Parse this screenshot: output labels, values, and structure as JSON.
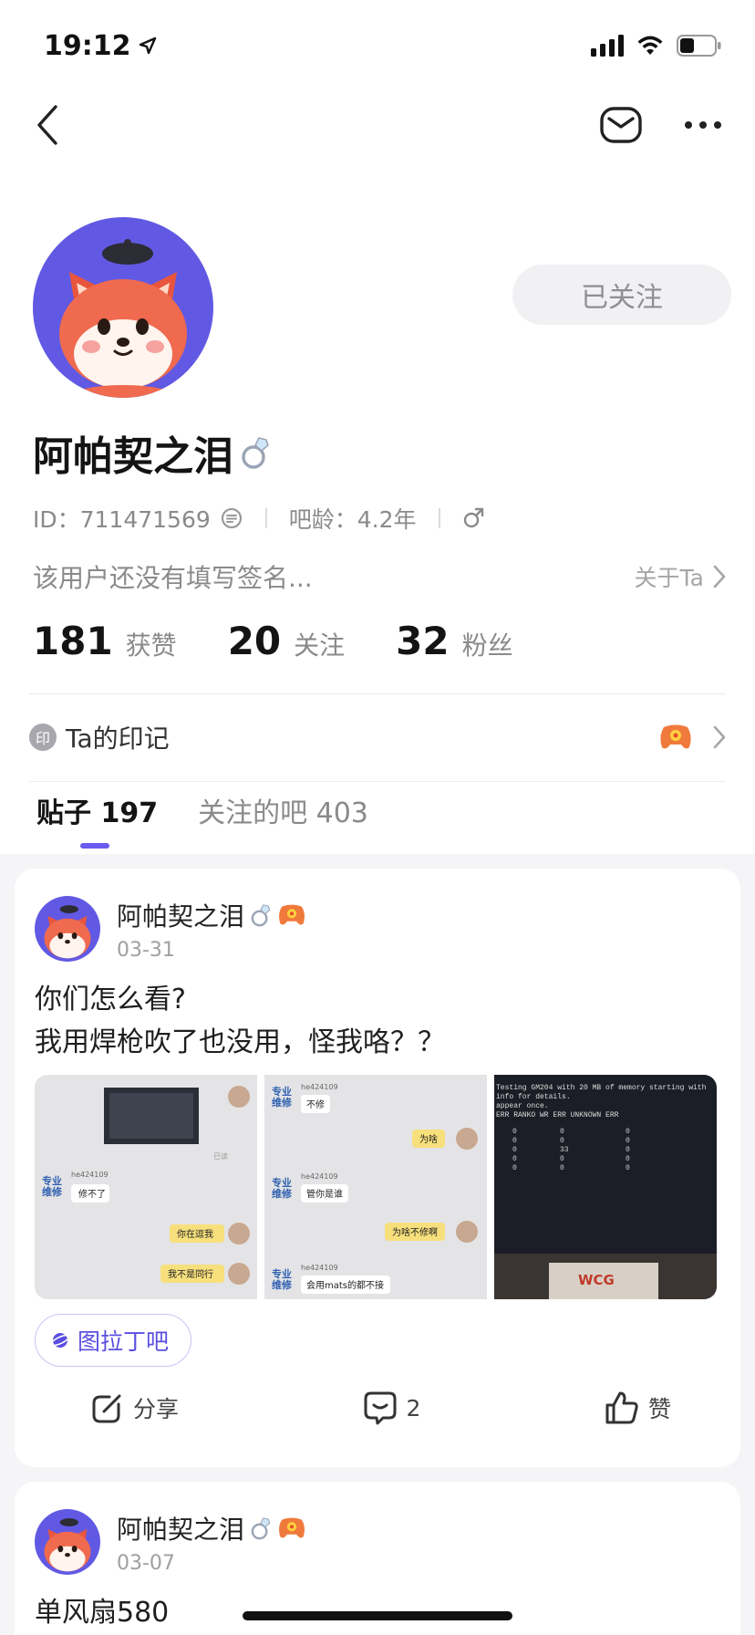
{
  "status": {
    "time": "19:12"
  },
  "profile": {
    "follow_label": "已关注",
    "name": "阿帕契之泪",
    "id_text": "ID：711471569",
    "age_text": "吧龄：4.2年",
    "signature": "该用户还没有填写签名...",
    "about_label": "关于Ta",
    "stats": [
      {
        "num": "181",
        "label": "获赞"
      },
      {
        "num": "20",
        "label": "关注"
      },
      {
        "num": "32",
        "label": "粉丝"
      }
    ]
  },
  "marks": {
    "badge": "印",
    "label": "Ta的印记"
  },
  "tabs": [
    {
      "label": "贴子 197"
    },
    {
      "label": "关注的吧 403"
    }
  ],
  "posts": [
    {
      "author": "阿帕契之泪",
      "date": "03-31",
      "line1": "你们怎么看?",
      "line2": "我用焊枪吹了也没用，怪我咯？？",
      "img1": {
        "caption": "已读",
        "user": "he424109",
        "msg1": "修不了",
        "reply1": "你在逗我",
        "reply2": "我不是同行"
      },
      "img2": {
        "user": "he424109",
        "msg1": "不修",
        "reply1": "为啥",
        "msg2": "管你是谁",
        "reply2": "为啥不修啊",
        "msg3": "会用mats的都不接"
      },
      "img3": {
        "text1": "Testing GM204 with 20 MB of memory starting with",
        "text2": "info for details.",
        "text3": "appear once.",
        "text4": "ERR  RANKO WR ERR   UNKNOWN ERR",
        "brand": "WCG"
      },
      "tag": "图拉丁吧",
      "share_label": "分享",
      "comment_count": "2",
      "like_label": "赞"
    },
    {
      "author": "阿帕契之泪",
      "date": "03-07",
      "line1": "单风扇580"
    }
  ],
  "colors": {
    "accent": "#6a5cf0",
    "avatar_bg": "#6159e4",
    "fox": "#e8553e"
  }
}
